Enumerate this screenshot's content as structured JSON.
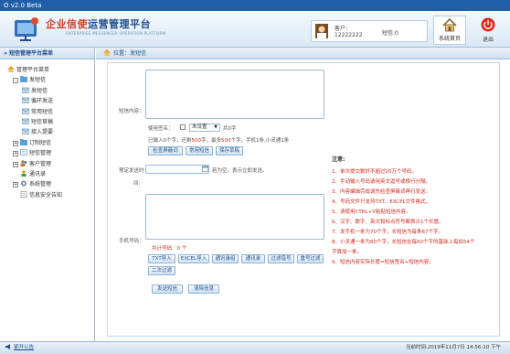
{
  "app": {
    "title": "O v2.0 Beta"
  },
  "header": {
    "brand_red": "企业信使",
    "brand_blue": "运营管理平台",
    "brand_sub": "ENTERPRISE MESSENGER OPERATION PLATFORM",
    "client_label": "客户：",
    "client_number": "12222222",
    "balance": "短信:0",
    "home_label": "系统首页",
    "exit_label": "退出"
  },
  "sidebar": {
    "title": "» 短信管理平台菜单",
    "items": [
      {
        "label": "管理平台菜单",
        "level": 1,
        "icon": "home-icon"
      },
      {
        "label": "发短信",
        "level": 2,
        "expand": "-",
        "icon": "folder-icon"
      },
      {
        "label": "发短信",
        "level": 3,
        "icon": "mail-icon"
      },
      {
        "label": "循环发送",
        "level": 3,
        "icon": "mail-icon"
      },
      {
        "label": "常用短信",
        "level": 3,
        "icon": "mail-icon"
      },
      {
        "label": "短信草稿",
        "level": 3,
        "icon": "mail-icon"
      },
      {
        "label": "接入提要",
        "level": 3,
        "icon": "mail-icon"
      },
      {
        "label": "订制短信",
        "level": 2,
        "expand": "+",
        "icon": "folder-icon"
      },
      {
        "label": "短信管理",
        "level": 2,
        "expand": "+",
        "icon": "folder-icon"
      },
      {
        "label": "客户管理",
        "level": 2,
        "expand": "+",
        "icon": "users-icon"
      },
      {
        "label": "通讯录",
        "level": 2,
        "expand": "",
        "icon": "contact-icon"
      },
      {
        "label": "系统管理",
        "level": 2,
        "expand": "+",
        "icon": "gear-icon"
      },
      {
        "label": "信息安全告知",
        "level": 2,
        "expand": "",
        "icon": "doc-icon"
      }
    ]
  },
  "main": {
    "location": "位置：发短信",
    "content_label": "短信内容：",
    "use_sign": "使用签名：",
    "sign_select": "未设置",
    "char_count": "共0字",
    "input_info_a": "已输入",
    "input_info_num": "0个字，还剩",
    "input_info_remain": "500",
    "input_info_b": "字，最多",
    "input_info_max": "500",
    "input_info_c": "个字，手机1条,小灵通1条",
    "btn_keyword": "检查屏蔽词",
    "btn_common": "常用短信",
    "btn_draft": "保存草稿",
    "schedule_label": "预定发送时",
    "schedule_label2": "间:",
    "schedule_hint": "若为空，表示立即发送。",
    "phone_label": "手机号码：",
    "total_label": "共计号码：",
    "total_value": "0 个",
    "btn_txt": "TXT导入",
    "btn_excel": "EXCEL导入",
    "btn_contacts": "通讯录组",
    "btn_address": "通讯录",
    "btn_filter": "过滤错号",
    "btn_dup": "重号过滤",
    "btn_second": "二次过滤",
    "btn_send": "发送短信",
    "btn_clear": "清除信息"
  },
  "notes": {
    "title": "注意:",
    "items": [
      "1、单次提交数好不超过20万个号码。",
      "2、手动输入号码请用英文逗号或换行分隔。",
      "3、内容编辑完成请先检查屏蔽词再行发送。",
      "4、号码文件只支持TXT、EXCEL文件格式。",
      "5、请使用CTRL+V粘贴短信内容。",
      "6、汉字、数字、英文和标点符号都表示1个长度。",
      "7、发手机一条为70个字，长短信为每条67个字。",
      "8、小灵通一条为60个字，长短信在每60个字的基础上每加54个",
      "字算加一条。",
      "9、短信内容实际长度=短信签名+短信内容。"
    ]
  },
  "status": {
    "notice": "紧开公告",
    "time": "当前时间:2019年11月7日 14:56:10 下午"
  }
}
